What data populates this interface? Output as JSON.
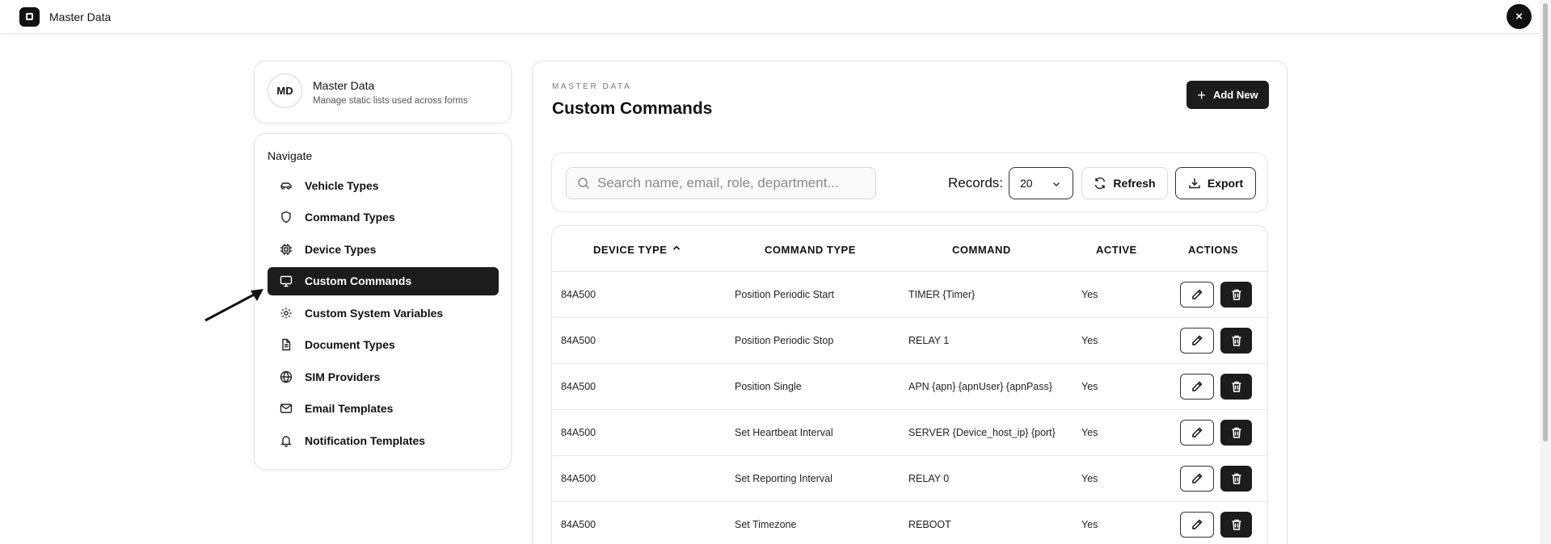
{
  "app": {
    "title": "Master Data",
    "close_icon": "×"
  },
  "profile": {
    "initials": "MD",
    "name": "Master Data",
    "description": "Manage static lists used across forms"
  },
  "nav": {
    "heading": "Navigate",
    "items": [
      {
        "label": "Vehicle Types",
        "icon": "car-icon",
        "active": false
      },
      {
        "label": "Command Types",
        "icon": "shield-icon",
        "active": false
      },
      {
        "label": "Device Types",
        "icon": "chip-icon",
        "active": false
      },
      {
        "label": "Custom Commands",
        "icon": "monitor-icon",
        "active": true
      },
      {
        "label": "Custom System Variables",
        "icon": "gear-icon",
        "active": false
      },
      {
        "label": "Document Types",
        "icon": "document-icon",
        "active": false
      },
      {
        "label": "SIM Providers",
        "icon": "globe-icon",
        "active": false
      },
      {
        "label": "Email Templates",
        "icon": "mail-icon",
        "active": false
      },
      {
        "label": "Notification Templates",
        "icon": "bell-icon",
        "active": false
      }
    ]
  },
  "main": {
    "eyebrow": "MASTER DATA",
    "title": "Custom Commands",
    "add_label": "Add New"
  },
  "toolbar": {
    "search_placeholder": "Search name, email, role, department...",
    "records_label": "Records:",
    "records_value": "20",
    "refresh_label": "Refresh",
    "export_label": "Export"
  },
  "table": {
    "headers": {
      "device_type": "DEVICE TYPE",
      "command_type": "COMMAND TYPE",
      "command": "COMMAND",
      "active": "ACTIVE",
      "actions": "ACTIONS"
    },
    "rows": [
      {
        "device_type": "84A500",
        "command_type": "Position Periodic Start",
        "command": "TIMER {Timer}",
        "active": "Yes"
      },
      {
        "device_type": "84A500",
        "command_type": "Position Periodic Stop",
        "command": "RELAY 1",
        "active": "Yes"
      },
      {
        "device_type": "84A500",
        "command_type": "Position Single",
        "command": "APN {apn} {apnUser} {apnPass}",
        "active": "Yes"
      },
      {
        "device_type": "84A500",
        "command_type": "Set Heartbeat Interval",
        "command": "SERVER {Device_host_ip} {port}",
        "active": "Yes"
      },
      {
        "device_type": "84A500",
        "command_type": "Set Reporting Interval",
        "command": "RELAY 0",
        "active": "Yes"
      },
      {
        "device_type": "84A500",
        "command_type": "Set Timezone",
        "command": "REBOOT",
        "active": "Yes"
      }
    ]
  }
}
